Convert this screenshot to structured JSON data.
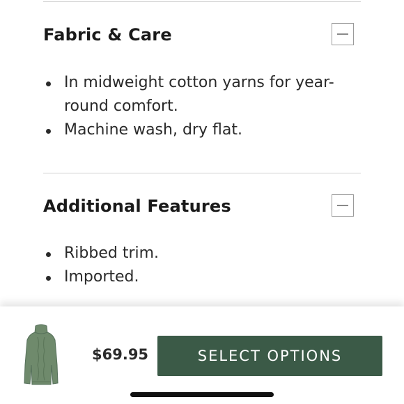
{
  "sections": [
    {
      "title": "Fabric & Care",
      "toggle_icon": "minus-collapse-icon",
      "bullets": [
        "In midweight cotton yarns for year-round comfort.",
        "Machine wash, dry flat."
      ]
    },
    {
      "title": "Additional Features",
      "toggle_icon": "minus-collapse-icon",
      "bullets": [
        "Ribbed trim.",
        "Imported."
      ]
    }
  ],
  "purchase_bar": {
    "thumbnail_icon": "sweater-thumbnail",
    "price": "$69.95",
    "select_button_label": "SELECT OPTIONS",
    "button_color": "#3b5a47",
    "sweater_color": "#6f8a6c"
  }
}
